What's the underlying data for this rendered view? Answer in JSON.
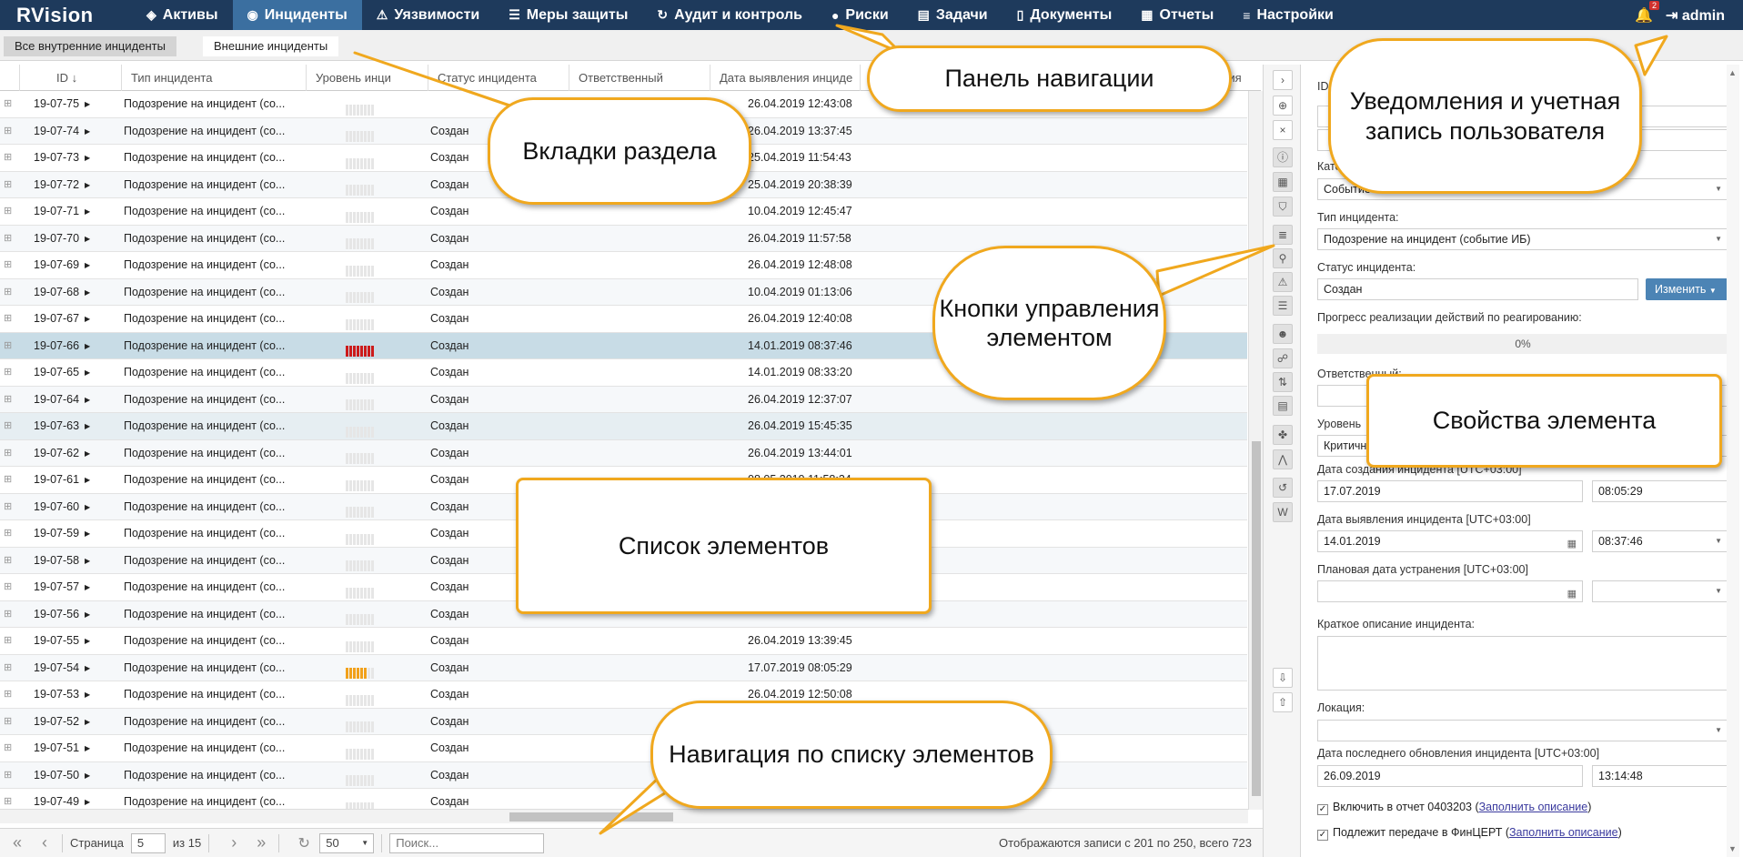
{
  "app": {
    "logo": "RVision"
  },
  "nav": [
    {
      "icon": "layers-icon",
      "glyph": "◈",
      "label": "Активы"
    },
    {
      "icon": "target-icon",
      "glyph": "◉",
      "label": "Инциденты",
      "active": true
    },
    {
      "icon": "warning-icon",
      "glyph": "⚠",
      "label": "Уязвимости"
    },
    {
      "icon": "checklist-icon",
      "glyph": "☰",
      "label": "Меры защиты"
    },
    {
      "icon": "cycle-icon",
      "glyph": "↻",
      "label": "Аудит и контроль"
    },
    {
      "icon": "alert-icon",
      "glyph": "●",
      "label": "Риски"
    },
    {
      "icon": "tasks-icon",
      "glyph": "▤",
      "label": "Задачи"
    },
    {
      "icon": "document-icon",
      "glyph": "▯",
      "label": "Документы"
    },
    {
      "icon": "reports-icon",
      "glyph": "▦",
      "label": "Отчеты"
    },
    {
      "icon": "settings-icon",
      "glyph": "≡",
      "label": "Настройки"
    }
  ],
  "header_right": {
    "notifications_count": "2",
    "user": "admin"
  },
  "tabs": [
    "Все внутренние инциденты",
    "Внешние инциденты"
  ],
  "columns": {
    "id": "ID",
    "sort_icon": "↓",
    "type": "Тип инцидента",
    "level": "Уровень инци",
    "status": "Статус инцидента",
    "responsible": "Ответственный",
    "date": "Дата выявления инциде",
    "last": "ения"
  },
  "rows": [
    {
      "id": "19-07-75",
      "type": "Подозрение на инцидент (со...",
      "level": "gray",
      "status": "",
      "date": "26.04.2019 12:43:08"
    },
    {
      "id": "19-07-74",
      "type": "Подозрение на инцидент (со...",
      "level": "gray",
      "status": "Создан",
      "date": "26.04.2019 13:37:45"
    },
    {
      "id": "19-07-73",
      "type": "Подозрение на инцидент (со...",
      "level": "gray",
      "status": "Создан",
      "date": "25.04.2019 11:54:43"
    },
    {
      "id": "19-07-72",
      "type": "Подозрение на инцидент (со...",
      "level": "gray",
      "status": "Создан",
      "date": "25.04.2019 20:38:39"
    },
    {
      "id": "19-07-71",
      "type": "Подозрение на инцидент (со...",
      "level": "gray",
      "status": "Создан",
      "date": "10.04.2019 12:45:47"
    },
    {
      "id": "19-07-70",
      "type": "Подозрение на инцидент (со...",
      "level": "gray",
      "status": "Создан",
      "date": "26.04.2019 11:57:58"
    },
    {
      "id": "19-07-69",
      "type": "Подозрение на инцидент (со...",
      "level": "gray",
      "status": "Создан",
      "date": "26.04.2019 12:48:08"
    },
    {
      "id": "19-07-68",
      "type": "Подозрение на инцидент (со...",
      "level": "gray",
      "status": "Создан",
      "date": "10.04.2019 01:13:06"
    },
    {
      "id": "19-07-67",
      "type": "Подозрение на инцидент (со...",
      "level": "gray",
      "status": "Создан",
      "date": "26.04.2019 12:40:08"
    },
    {
      "id": "19-07-66",
      "type": "Подозрение на инцидент (со...",
      "level": "red",
      "status": "Создан",
      "date": "14.01.2019 08:37:46",
      "selected": true
    },
    {
      "id": "19-07-65",
      "type": "Подозрение на инцидент (со...",
      "level": "gray",
      "status": "Создан",
      "date": "14.01.2019 08:33:20"
    },
    {
      "id": "19-07-64",
      "type": "Подозрение на инцидент (со...",
      "level": "gray",
      "status": "Создан",
      "date": "26.04.2019 12:37:07"
    },
    {
      "id": "19-07-63",
      "type": "Подозрение на инцидент (со...",
      "level": "gray",
      "status": "Создан",
      "date": "26.04.2019 15:45:35",
      "hover": true
    },
    {
      "id": "19-07-62",
      "type": "Подозрение на инцидент (со...",
      "level": "gray",
      "status": "Создан",
      "date": "26.04.2019 13:44:01"
    },
    {
      "id": "19-07-61",
      "type": "Подозрение на инцидент (со...",
      "level": "gray",
      "status": "Создан",
      "date": "08.05.2019 11:58:34"
    },
    {
      "id": "19-07-60",
      "type": "Подозрение на инцидент (со...",
      "level": "gray",
      "status": "Создан",
      "date": ""
    },
    {
      "id": "19-07-59",
      "type": "Подозрение на инцидент (со...",
      "level": "gray",
      "status": "Создан",
      "date": ""
    },
    {
      "id": "19-07-58",
      "type": "Подозрение на инцидент (со...",
      "level": "gray",
      "status": "Создан",
      "date": ""
    },
    {
      "id": "19-07-57",
      "type": "Подозрение на инцидент (со...",
      "level": "gray",
      "status": "Создан",
      "date": ""
    },
    {
      "id": "19-07-56",
      "type": "Подозрение на инцидент (со...",
      "level": "gray",
      "status": "Создан",
      "date": ""
    },
    {
      "id": "19-07-55",
      "type": "Подозрение на инцидент (со...",
      "level": "gray",
      "status": "Создан",
      "date": "26.04.2019 13:39:45"
    },
    {
      "id": "19-07-54",
      "type": "Подозрение на инцидент (со...",
      "level": "orange",
      "status": "Создан",
      "date": "17.07.2019 08:05:29"
    },
    {
      "id": "19-07-53",
      "type": "Подозрение на инцидент (со...",
      "level": "gray",
      "status": "Создан",
      "date": "26.04.2019 12:50:08"
    },
    {
      "id": "19-07-52",
      "type": "Подозрение на инцидент (со...",
      "level": "gray",
      "status": "Создан",
      "date": ""
    },
    {
      "id": "19-07-51",
      "type": "Подозрение на инцидент (со...",
      "level": "gray",
      "status": "Создан",
      "date": ""
    },
    {
      "id": "19-07-50",
      "type": "Подозрение на инцидент (со...",
      "level": "gray",
      "status": "Создан",
      "date": ""
    },
    {
      "id": "19-07-49",
      "type": "Подозрение на инцидент (со...",
      "level": "gray",
      "status": "Создан",
      "date": ""
    }
  ],
  "pager": {
    "page_label": "Страница",
    "page": "5",
    "of_label": "из 15",
    "page_size": "50",
    "search_placeholder": "Поиск...",
    "status": "Отображаются записи с 201 по 250, всего 723"
  },
  "toolbar_icons": [
    {
      "name": "collapse-icon",
      "glyph": "›"
    },
    {
      "name": "add-icon",
      "glyph": "⊕"
    },
    {
      "name": "close-icon",
      "glyph": "×"
    },
    {
      "name": "info-icon",
      "glyph": "ⓘ"
    },
    {
      "name": "table-icon",
      "glyph": "▦"
    },
    {
      "name": "shield-icon",
      "glyph": "⛉"
    },
    {
      "name": "database-icon",
      "glyph": "≣"
    },
    {
      "name": "paperclip-icon",
      "glyph": "⚲"
    },
    {
      "name": "warning-icon",
      "glyph": "⚠"
    },
    {
      "name": "list-icon",
      "glyph": "☰"
    },
    {
      "name": "user-icon",
      "glyph": "☻"
    },
    {
      "name": "chat-icon",
      "glyph": "☍"
    },
    {
      "name": "sort-icon",
      "glyph": "⇅"
    },
    {
      "name": "notes-icon",
      "glyph": "▤"
    },
    {
      "name": "puzzle-icon",
      "glyph": "✤"
    },
    {
      "name": "graph-icon",
      "glyph": "⋀"
    },
    {
      "name": "history-icon",
      "glyph": "↺"
    },
    {
      "name": "word-icon",
      "glyph": "W"
    },
    {
      "name": "import-icon",
      "glyph": "⇩"
    },
    {
      "name": "export-icon",
      "glyph": "⇧"
    }
  ],
  "props": {
    "id_label": "ID",
    "category_label": "Кате",
    "category_value": "Событие ИБ",
    "type_label": "Тип инцидента:",
    "type_value": "Подозрение на инцидент (событие ИБ)",
    "status_label": "Статус инцидента:",
    "status_value": "Создан",
    "change_button": "Изменить",
    "progress_label": "Прогресс реализации действий по реагированию:",
    "progress_value": "0%",
    "responsible_label": "Ответственный:",
    "level_label": "Уровень",
    "level_value": "Критичный",
    "created_label": "Дата создания инцидента [UTC+03:00]",
    "created_date": "17.07.2019",
    "created_time": "08:05:29",
    "detected_label": "Дата выявления инцидента [UTC+03:00]",
    "detected_date": "14.01.2019",
    "detected_time": "08:37:46",
    "planned_label": "Плановая дата устранения [UTC+03:00]",
    "summary_label": "Краткое описание инцидента:",
    "location_label": "Локация:",
    "updated_label": "Дата последнего обновления инцидента [UTC+03:00]",
    "updated_date": "26.09.2019",
    "updated_time": "13:14:48",
    "check1_text": "Включить в отчет 0403203 (",
    "check1_link": "Заполнить описание",
    "check2_text": "Подлежит передаче в ФинЦЕРТ (",
    "check2_link": "Заполнить описание",
    "close_paren": ")"
  },
  "callouts": {
    "nav_panel": "Панель навигации",
    "notifications": "Уведомления и учетная запись пользователя",
    "section_tabs": "Вкладки раздела",
    "element_buttons": "Кнопки управления элементом",
    "element_props": "Свойства элемента",
    "element_list": "Список элементов",
    "list_nav": "Навигация по списку элементов"
  },
  "colors": {
    "nav_bg": "#1e3a5c",
    "nav_active": "#3b6fa0",
    "callout_border": "#f0a81e",
    "severity_red": "#cc1b1b",
    "severity_orange": "#f1a11b"
  }
}
